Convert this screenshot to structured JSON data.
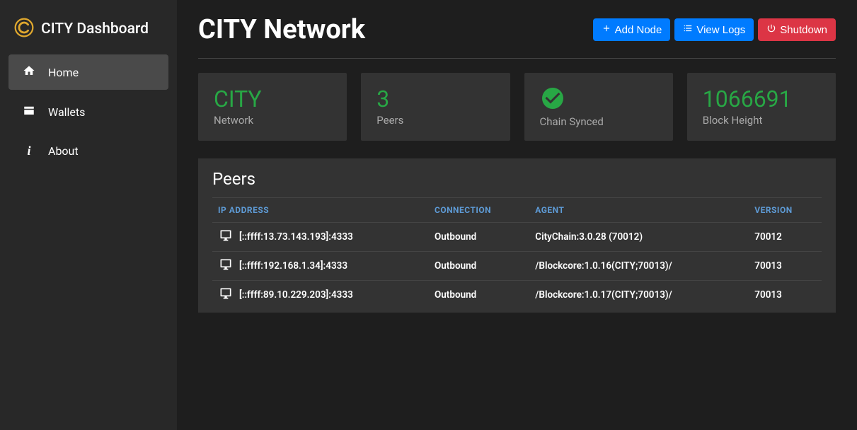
{
  "brand": {
    "text": "CITY Dashboard"
  },
  "nav": {
    "items": [
      {
        "label": "Home",
        "icon": "home-icon",
        "active": true
      },
      {
        "label": "Wallets",
        "icon": "wallets-icon",
        "active": false
      },
      {
        "label": "About",
        "icon": "info-icon",
        "active": false
      }
    ]
  },
  "header": {
    "title": "CITY Network",
    "buttons": {
      "add_node": "Add Node",
      "view_logs": "View Logs",
      "shutdown": "Shutdown"
    }
  },
  "status_cards": {
    "network": {
      "value": "CITY",
      "label": "Network"
    },
    "peers": {
      "value": "3",
      "label": "Peers"
    },
    "sync": {
      "label": "Chain Synced"
    },
    "height": {
      "value": "1066691",
      "label": "Block Height"
    }
  },
  "peers_panel": {
    "title": "Peers",
    "columns": {
      "ip": "IP ADDRESS",
      "connection": "CONNECTION",
      "agent": "AGENT",
      "version": "VERSION"
    },
    "rows": [
      {
        "ip": "[::ffff:13.73.143.193]:4333",
        "connection": "Outbound",
        "agent": "CityChain:3.0.28 (70012)",
        "version": "70012"
      },
      {
        "ip": "[::ffff:192.168.1.34]:4333",
        "connection": "Outbound",
        "agent": "/Blockcore:1.0.16(CITY;70013)/",
        "version": "70013"
      },
      {
        "ip": "[::ffff:89.10.229.203]:4333",
        "connection": "Outbound",
        "agent": "/Blockcore:1.0.17(CITY;70013)/",
        "version": "70013"
      }
    ]
  }
}
